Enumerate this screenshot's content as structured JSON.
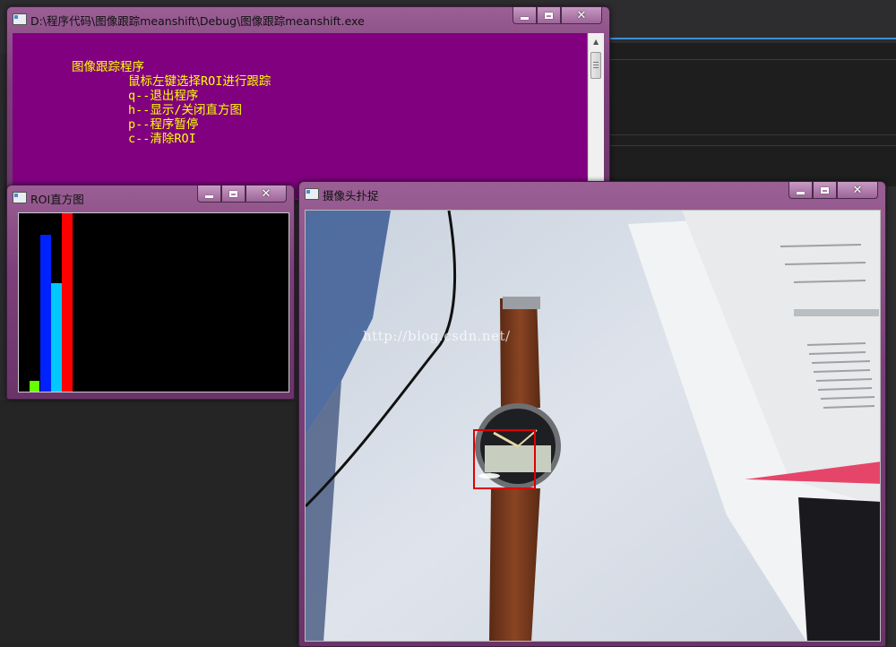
{
  "console_window": {
    "title": "D:\\程序代码\\图像跟踪meanshift\\Debug\\图像跟踪meanshift.exe",
    "lines": [
      "图像跟踪程序",
      "鼠标左键选择ROI进行跟踪",
      "q--退出程序",
      "h--显示/关闭直方图",
      "p--程序暂停",
      "c--清除ROI"
    ],
    "background": "#800080",
    "text_color": "#ffff00"
  },
  "roi_window": {
    "title": "ROI直方图",
    "histogram_bars": [
      {
        "color": "#66ff00",
        "level": 0.06
      },
      {
        "color": "#0022ff",
        "level": 0.88
      },
      {
        "color": "#00c8ff",
        "level": 0.61
      },
      {
        "color": "#ff0000",
        "level": 1.0
      }
    ]
  },
  "camera_window": {
    "title": "摄像头扑捉",
    "watermark": "http://blog.csdn.net/",
    "roi_box_color": "#e00000"
  },
  "window_controls": {
    "minimize_icon": "minimize-icon",
    "maximize_icon": "maximize-icon",
    "close_icon": "close-icon"
  }
}
